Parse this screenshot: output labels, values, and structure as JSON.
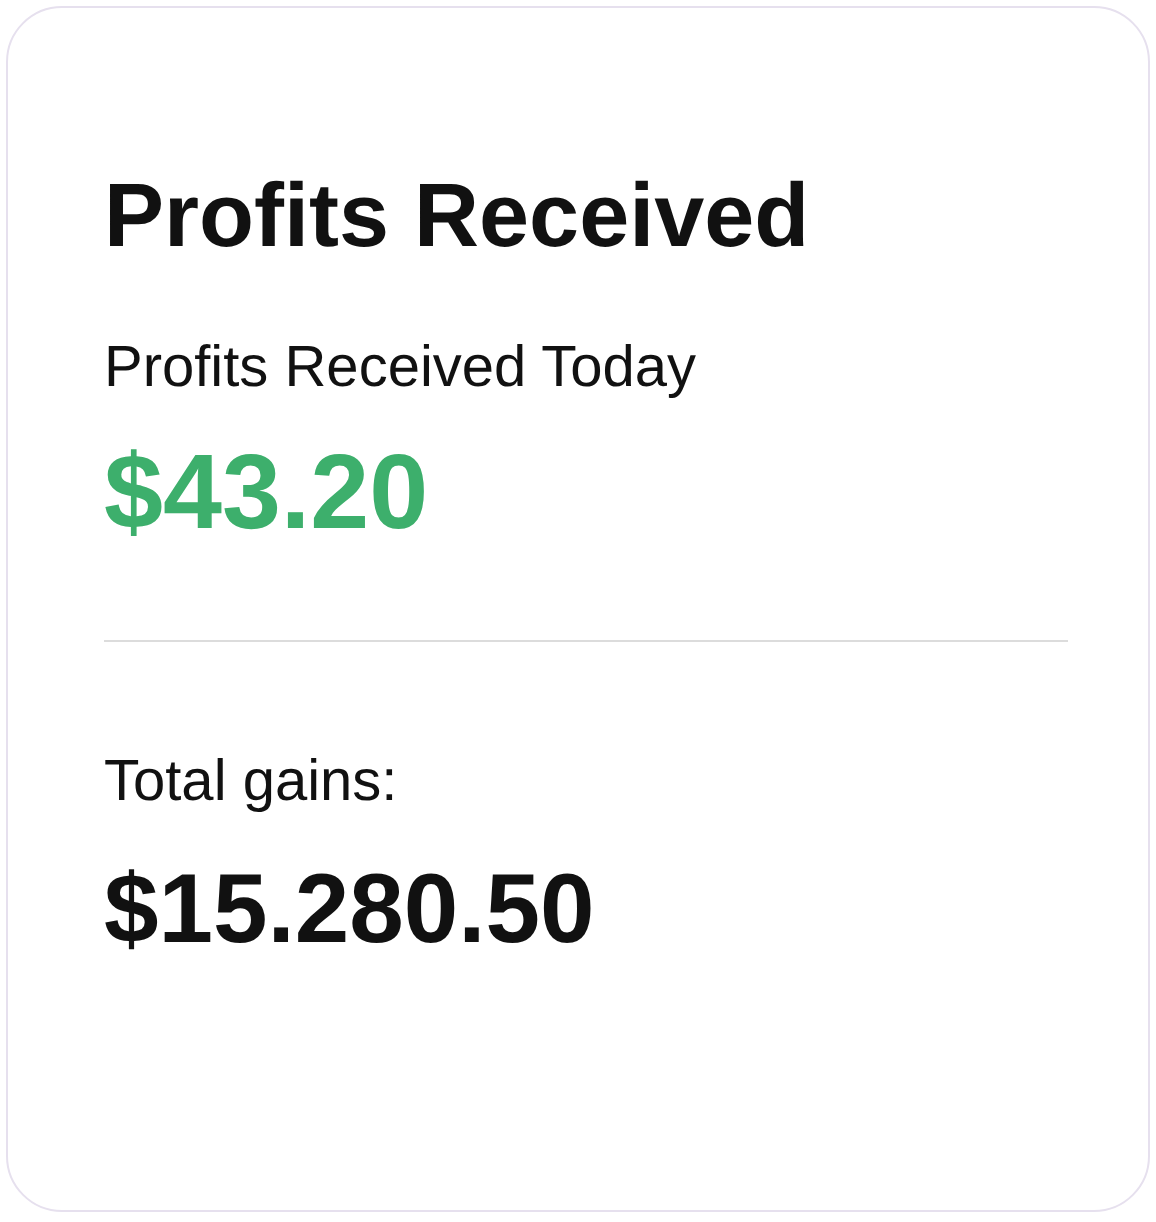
{
  "card": {
    "title": "Profits Received",
    "today": {
      "label": "Profits Received Today",
      "value": "$43.20"
    },
    "total": {
      "label": "Total gains:",
      "value": "$15.280.50"
    }
  }
}
